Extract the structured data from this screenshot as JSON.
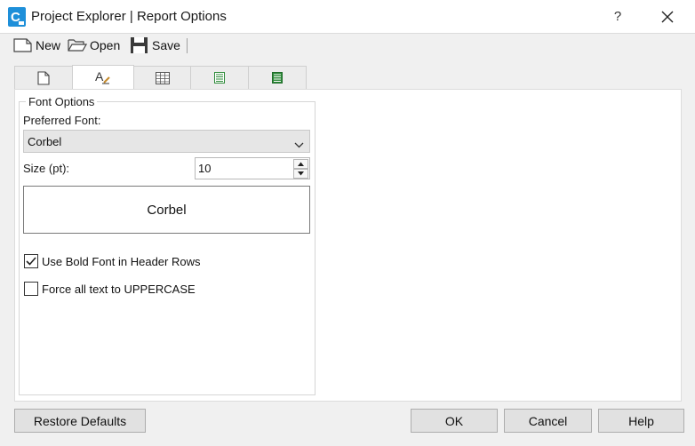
{
  "window": {
    "title": "Project Explorer | Report Options",
    "help_label": "?"
  },
  "toolbar": {
    "new_label": "New",
    "open_label": "Open",
    "save_label": "Save"
  },
  "tabs": [
    {
      "icon": "document-icon",
      "active": false
    },
    {
      "icon": "font-style-icon",
      "active": true
    },
    {
      "icon": "table-grid-icon",
      "active": false
    },
    {
      "icon": "spreadsheet-icon",
      "active": false
    },
    {
      "icon": "green-spreadsheet-icon",
      "active": false
    }
  ],
  "font_options": {
    "group_title": "Font Options",
    "preferred_font_label": "Preferred Font:",
    "preferred_font_value": "Corbel",
    "size_label": "Size (pt):",
    "size_value": "10",
    "preview_text": "Corbel",
    "bold_header_label": "Use Bold Font in Header Rows",
    "bold_header_checked": true,
    "uppercase_label": "Force all text to UPPERCASE",
    "uppercase_checked": false
  },
  "footer": {
    "restore_label": "Restore Defaults",
    "ok_label": "OK",
    "cancel_label": "Cancel",
    "help_label": "Help"
  },
  "colors": {
    "app_icon_blue": "#1e8fd9",
    "green_icon": "#2e8b3a",
    "background": "#f0f0f0"
  }
}
